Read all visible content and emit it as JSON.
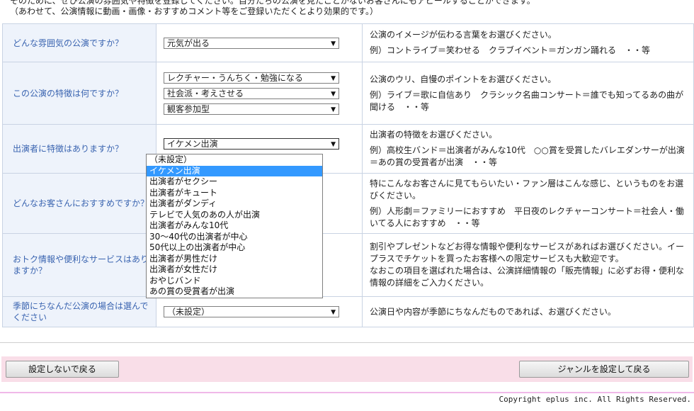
{
  "intro": {
    "line1": "そのために、ぜひ公演の雰囲気や特徴を登録してください。自分たちの公演を見たことがないお客さんにもアピールすることができます。",
    "line2": "（あわせて、公演情報に動画・画像・おすすめコメント等をご登録いただくとより効果的です。）"
  },
  "rows": [
    {
      "question": "どんな雰囲気の公演ですか？",
      "selects": [
        "元気が出る"
      ],
      "desc": "公演のイメージが伝わる言葉をお選びください。",
      "example": "例）コントライブ＝笑わせる　クラブイベント＝ガンガン踊れる　・・等"
    },
    {
      "question": "この公演の特徴は何ですか？",
      "selects": [
        "レクチャー・うんちく・勉強になる",
        "社会派・考えさせる",
        "観客参加型"
      ],
      "desc": "公演のウリ、自慢のポイントをお選びください。",
      "example": "例）ライブ＝歌に自信あり　クラシック名曲コンサート＝誰でも知ってるあの曲が聞ける　・・等"
    },
    {
      "question": "出演者に特徴はありますか？",
      "selects": [
        "イケメン出演"
      ],
      "desc": "出演者の特徴をお選びください。",
      "example": "例）高校生バンド＝出演者がみんな10代　○○賞を受賞したバレエダンサーが出演＝あの賞の受賞者が出演　・・等"
    },
    {
      "question": "どんなお客さんにおすすめですか？",
      "selects": [],
      "desc": "特にこんなお客さんに見てもらいたい・ファン層はこんな感じ、というものをお選びください。",
      "example": "例）人形劇＝ファミリーにおすすめ　平日夜のレクチャーコンサート＝社会人・働いてる人におすすめ　・・等"
    },
    {
      "question": "おトク情報や便利なサービスはありますか？",
      "selects": [],
      "desc": "割引やプレゼントなどお得な情報や便利なサービスがあればお選びください。イープラスでチケットを買ったお客様への限定サービスも大歓迎です。",
      "example": "なおこの項目を選ばれた場合は、公演詳細情報の「販売情報」に必ずお得・便利な情報の詳細をご入力ください。"
    },
    {
      "question": "季節にちなんだ公演の場合は選んでください",
      "selects": [
        "（未設定）"
      ],
      "desc": "公演日や内容が季節にちなんだものであれば、お選びください。",
      "example": ""
    }
  ],
  "dropdown": {
    "options": [
      "（未設定）",
      "イケメン出演",
      "出演者がセクシー",
      "出演者がキュート",
      "出演者がダンディ",
      "テレビで人気のあの人が出演",
      "出演者がみんな10代",
      "30～40代の出演者が中心",
      "50代以上の出演者が中心",
      "出演者が男性だけ",
      "出演者が女性だけ",
      "おやじバンド",
      "あの賞の受賞者が出演"
    ],
    "highlighted_index": 1
  },
  "buttons": {
    "back_label": "設定しないで戻る",
    "save_label": "ジャンルを設定して戻る"
  },
  "footer": {
    "copyright": "Copyright eplus inc. All Rights Reserved."
  },
  "colors": {
    "question_bg": "#eef3fb",
    "question_text": "#3a64b0",
    "button_bar_bg": "#f9dee8",
    "highlight": "#3399ff"
  }
}
